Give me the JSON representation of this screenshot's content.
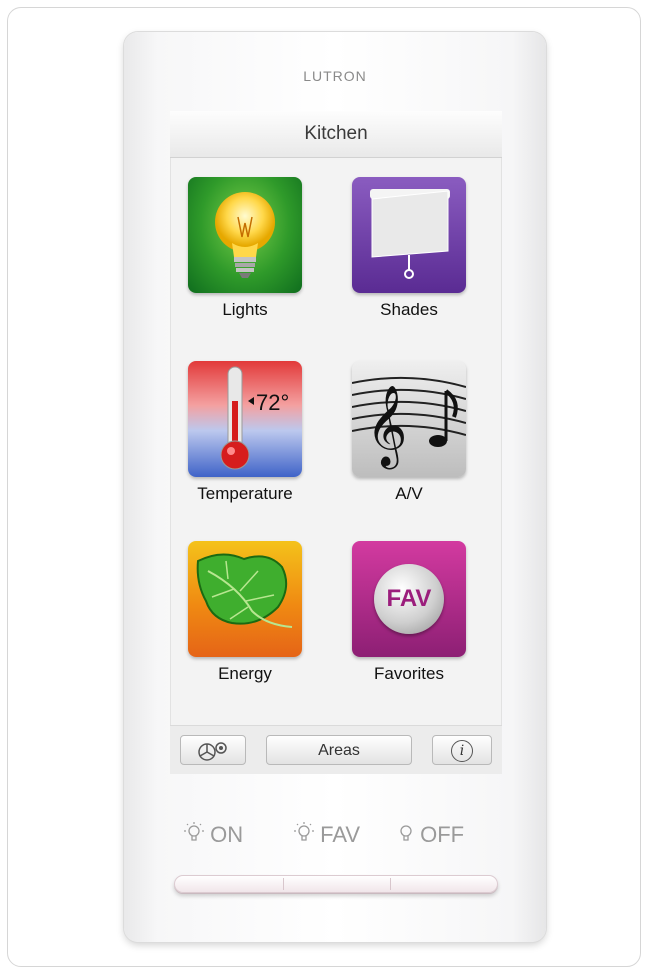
{
  "brand": "LUTRON",
  "screen_title": "Kitchen",
  "tiles": [
    {
      "label": "Lights",
      "icon": "light-bulb-icon"
    },
    {
      "label": "Shades",
      "icon": "window-shade-icon"
    },
    {
      "label": "Temperature",
      "icon": "thermometer-icon",
      "reading": "72°"
    },
    {
      "label": "A/V",
      "icon": "music-notes-icon"
    },
    {
      "label": "Energy",
      "icon": "leaf-icon"
    },
    {
      "label": "Favorites",
      "icon": "fav-icon",
      "badge": "FAV"
    }
  ],
  "bottom_bar": {
    "left_icon": "settings-icon",
    "center_label": "Areas",
    "right_icon": "info-icon",
    "right_glyph": "i"
  },
  "hard_buttons": [
    {
      "label": "ON",
      "icon": "light-on-icon"
    },
    {
      "label": "FAV",
      "icon": "light-fav-icon"
    },
    {
      "label": "OFF",
      "icon": "light-off-icon"
    }
  ],
  "colors": {
    "lights": "#2f9a2a",
    "shades": "#6a3aa6",
    "temperature_hot": "#e23a3a",
    "temperature_cold": "#3f63c8",
    "energy": "#f08a12",
    "favorites": "#b02c8c"
  }
}
